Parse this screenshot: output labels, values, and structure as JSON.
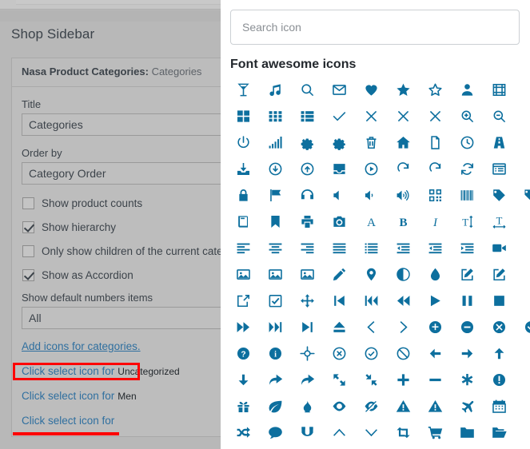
{
  "left_panel": {
    "pane_title": "Shop Sidebar",
    "widget": {
      "header_name": "Nasa Product Categories:",
      "header_instance": "Categories",
      "fields": [
        {
          "label": "Title",
          "value": "Categories",
          "type": "text"
        },
        {
          "label": "Order by",
          "value": "Category Order",
          "type": "select"
        }
      ],
      "checkboxes": [
        {
          "label": "Show product counts",
          "checked": false
        },
        {
          "label": "Show hierarchy",
          "checked": true
        },
        {
          "label": "Only show children of the current category",
          "checked": false
        },
        {
          "label": "Show as Accordion",
          "checked": true
        }
      ],
      "numbers_field": {
        "label": "Show default numbers items",
        "value": "All"
      },
      "add_icons_link": "Add icons for categories.",
      "category_rows": [
        {
          "link": "Click select icon for",
          "name": "Uncategorized"
        },
        {
          "link": "Click select icon for",
          "name": "Men"
        },
        {
          "link": "Click select icon for",
          "name": ""
        }
      ]
    }
  },
  "picker": {
    "search": {
      "value": "",
      "placeholder": "Search icon"
    },
    "section_title": "Font awesome icons",
    "accent_color": "#0d6f9e",
    "annotation_color": "#ff0000",
    "icons": [
      "glass",
      "music",
      "search",
      "envelope-o",
      "heart",
      "star",
      "star-o",
      "user",
      "film",
      "",
      "th-large",
      "th",
      "th-list",
      "check",
      "times",
      "close",
      "remove",
      "search-plus",
      "search-minus",
      "",
      "power-off",
      "signal",
      "cog",
      "gear",
      "trash-o",
      "home",
      "file-o",
      "clock-o",
      "road",
      "",
      "download",
      "arrow-circle-o-down",
      "arrow-circle-o-up",
      "inbox",
      "play-circle-o",
      "repeat",
      "rotate-right",
      "refresh",
      "list-alt",
      "",
      "lock",
      "flag",
      "headphones",
      "volume-off",
      "volume-down",
      "volume-up",
      "qrcode",
      "barcode",
      "tag",
      "tags",
      "book",
      "bookmark",
      "print",
      "camera",
      "font",
      "bold",
      "italic",
      "text-height",
      "text-width",
      "",
      "align-left",
      "align-center",
      "align-right",
      "align-justify",
      "list",
      "dedent",
      "outdent",
      "indent",
      "video-camera",
      "",
      "picture-o",
      "image",
      "photo",
      "pencil",
      "map-marker",
      "adjust",
      "tint",
      "edit",
      "pencil-square-o",
      "",
      "share-square-o",
      "check-square-o",
      "arrows",
      "step-backward",
      "fast-backward",
      "backward",
      "play",
      "pause",
      "stop",
      "",
      "forward",
      "fast-forward",
      "step-forward",
      "eject",
      "chevron-left",
      "chevron-right",
      "plus-circle",
      "minus-circle",
      "times-circle",
      "check-circle",
      "question-circle",
      "info-circle",
      "crosshairs",
      "times-circle-o",
      "check-circle-o",
      "ban",
      "arrow-left",
      "arrow-right",
      "arrow-up",
      "",
      "arrow-down",
      "share",
      "mail-forward",
      "expand",
      "compress",
      "plus",
      "minus",
      "asterisk",
      "exclamation-circle",
      "",
      "gift",
      "leaf",
      "fire",
      "eye",
      "eye-slash",
      "exclamation-triangle",
      "warning",
      "plane",
      "calendar",
      "",
      "random",
      "comment",
      "magnet",
      "chevron-up",
      "chevron-down",
      "retweet",
      "shopping-cart",
      "folder",
      "folder-open",
      ""
    ]
  }
}
